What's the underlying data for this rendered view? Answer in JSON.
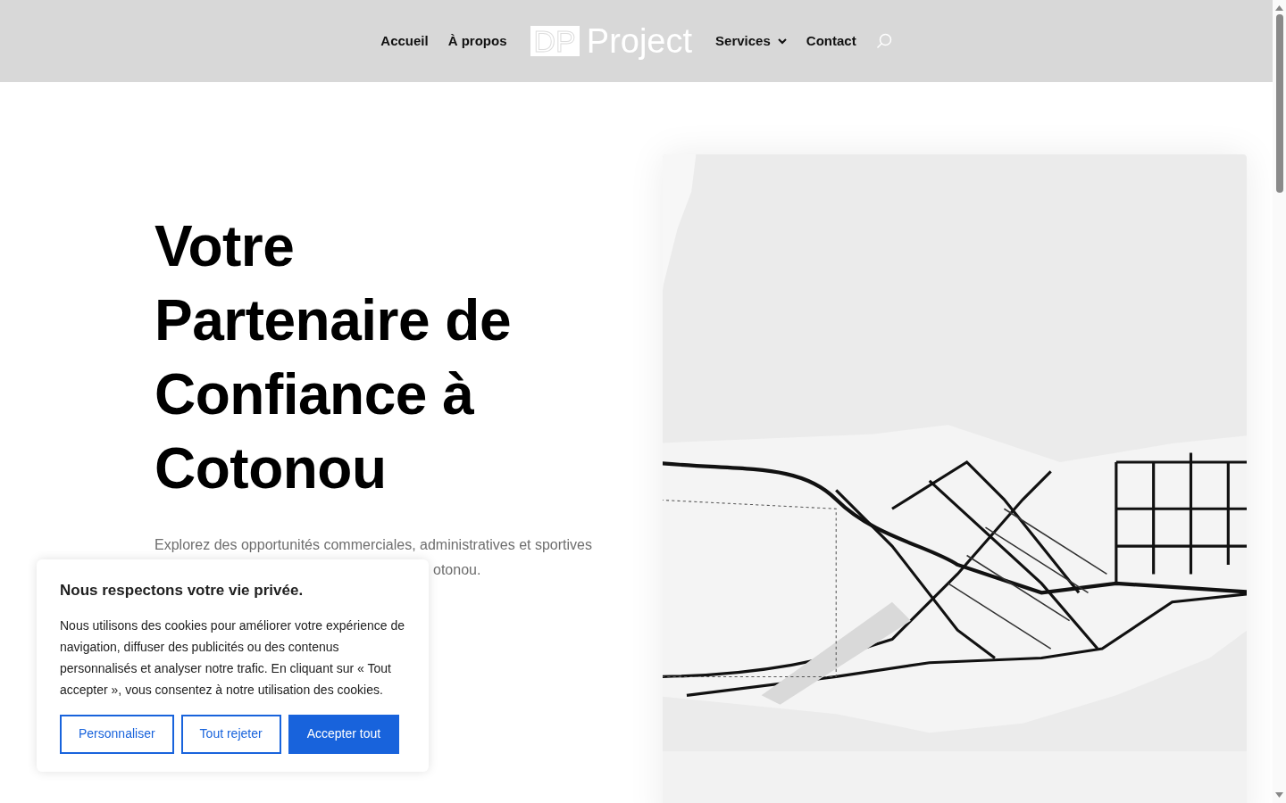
{
  "nav": {
    "items": [
      {
        "label": "Accueil",
        "has_menu": false
      },
      {
        "label": "À propos",
        "has_menu": false
      }
    ],
    "logo": {
      "mark": "DP",
      "word": "Project"
    },
    "items_right": [
      {
        "label": "Services",
        "has_menu": true
      },
      {
        "label": "Contact",
        "has_menu": false
      }
    ]
  },
  "hero": {
    "title": "Votre Partenaire de Confiance à Cotonou",
    "intro_line": "Explorez des opportunités commerciales, administratives et sportives",
    "intro_tail": "otonou."
  },
  "cookie_banner": {
    "title": "Nous respectons votre vie privée.",
    "text": "Nous utilisons des cookies pour améliorer votre expérience de navigation, diffuser des publicités ou des contenus personnalisés et analyser notre trafic. En cliquant sur « Tout accepter », vous consentez à notre utilisation des cookies.",
    "buttons": [
      {
        "label": "Personnaliser",
        "kind": "outline"
      },
      {
        "label": "Tout rejeter",
        "kind": "outline"
      },
      {
        "label": "Accepter tout",
        "kind": "primary"
      }
    ]
  }
}
